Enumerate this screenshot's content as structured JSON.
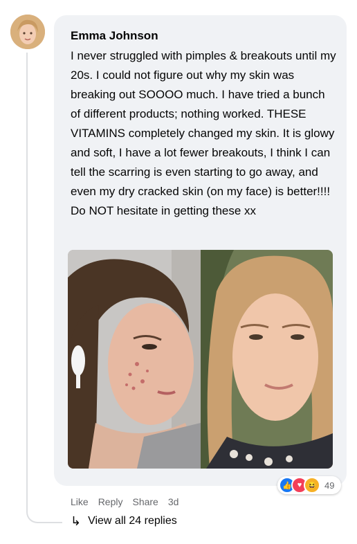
{
  "comment": {
    "author": "Emma Johnson",
    "text": "I never struggled with pimples & breakouts until my 20s. I could not figure out why my skin was breaking out SOOOO much. I have tried a bunch of different products; nothing worked. THESE VITAMINS completely changed my skin. It is glowy and soft, I have a lot fewer breakouts, I think I can tell the scarring is even starting to go away, and even my dry cracked skin (on my face) is better!!!! Do NOT hesitate in getting these xx",
    "reactions": {
      "icons": [
        "like-icon",
        "love-icon",
        "haha-icon"
      ],
      "count": "49"
    }
  },
  "actions": {
    "like": "Like",
    "reply": "Reply",
    "share": "Share",
    "time": "3d"
  },
  "replies": {
    "label": "View all 24 replies",
    "icon": "reply-arrow-icon"
  },
  "colors": {
    "bubble": "#f0f2f5",
    "muted": "#65676b",
    "like": "#1877f2",
    "love": "#f33e58",
    "haha": "#f7b125"
  }
}
